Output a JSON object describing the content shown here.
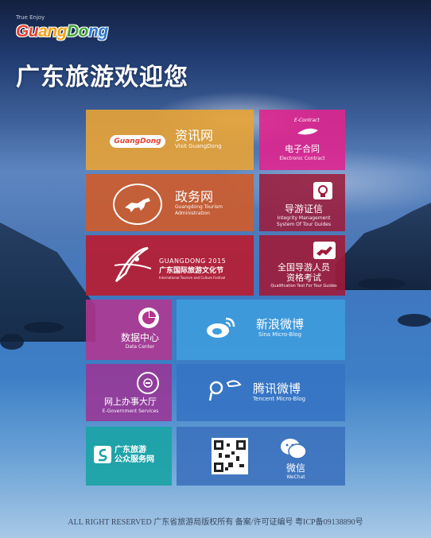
{
  "colors": {
    "info": "#e8a335",
    "contract": "#e0258f",
    "gov": "#cf5b2a",
    "guide_cert": "#9c1c3c",
    "festival": "#b81d32",
    "exam": "#a01b39",
    "data_center": "#b3368f",
    "sina": "#3e9fdf",
    "eservices": "#9b3596",
    "tencent": "#3673c4",
    "public_service": "#18a3a4",
    "wechat": "#3b71bd"
  },
  "header": {
    "tagline": "True Enjoy",
    "brand_letters": [
      "Gu",
      "ang",
      "Do",
      "ng"
    ],
    "title": "广东旅游欢迎您"
  },
  "tiles": {
    "info": {
      "cn": "资讯网",
      "en": "Visit GuangDong",
      "logo_text": "GuangDong"
    },
    "contract": {
      "badge": "E-Contract",
      "cn": "电子合同",
      "en": "Electronic Contract"
    },
    "gov": {
      "cn": "政务网",
      "en1": "Guangdong Tourism",
      "en2": "Administration"
    },
    "guide_cert": {
      "cn": "导游证信",
      "en1": "Integrity Management",
      "en2": "System Of Tour Guides"
    },
    "festival": {
      "title_en": "GUANGDONG 2015",
      "cn": "广东国际旅游文化节",
      "en": "International Tourism and Culture Festival"
    },
    "exam": {
      "cn1": "全国导游人员",
      "cn2": "资格考试",
      "en": "Qualification Test For Tour Guides"
    },
    "data_center": {
      "cn": "数据中心",
      "en": "Data Center"
    },
    "sina": {
      "cn": "新浪微博",
      "en": "Sina Micro-Blog"
    },
    "eservices": {
      "cn": "网上办事大厅",
      "en": "E-Government Services"
    },
    "tencent": {
      "cn": "腾讯微博",
      "en": "Tencent Micro-Blog"
    },
    "public_service": {
      "cn1": "广东旅游",
      "cn2": "公众服务网"
    },
    "wechat": {
      "cn": "微信",
      "en": "WeChat"
    }
  },
  "footer": {
    "text": "ALL RIGHT RESERVED   广东省旅游局版权所有 备案/许可证编号 粤ICP备09138890号"
  }
}
